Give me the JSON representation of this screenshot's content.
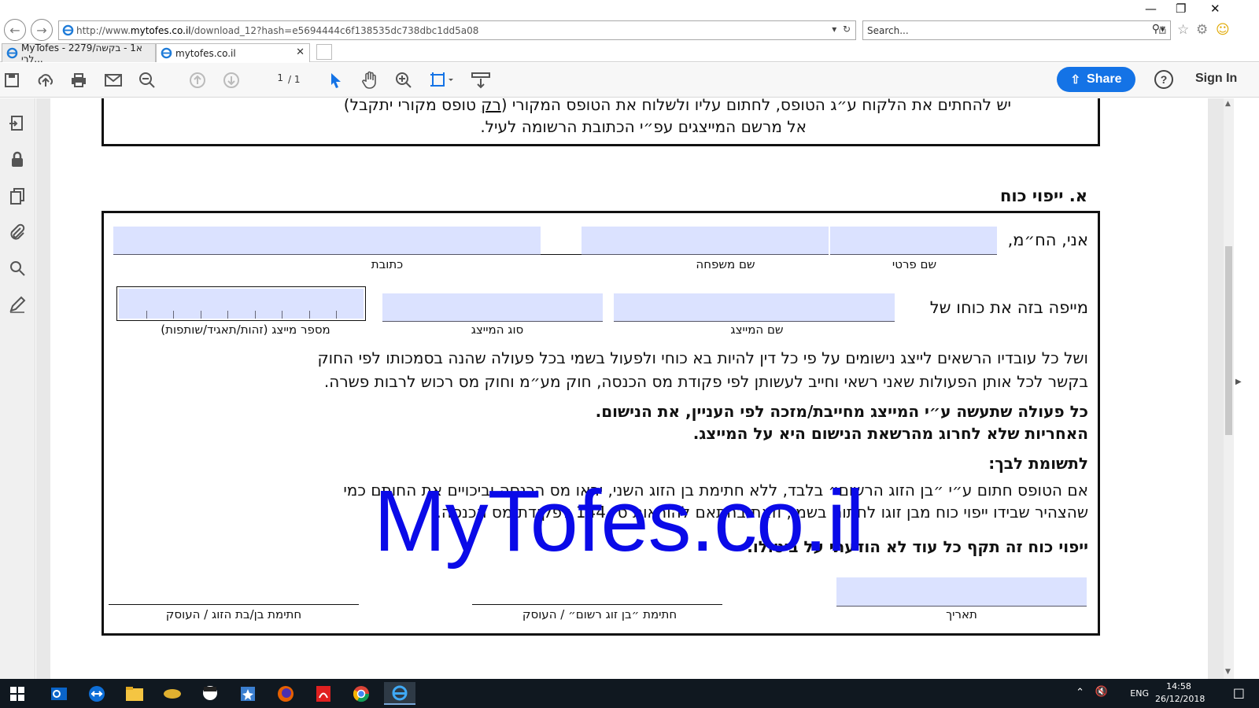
{
  "browser": {
    "address": {
      "prefix": "http://www.",
      "host": "mytofes.co.il",
      "path": "/download_12?hash=e5694444c6f138535dc738dbc1dd5a08"
    },
    "search_placeholder": "Search...",
    "tabs": [
      {
        "label": "MyTofes - 2279/א1 - בקשה לרי...",
        "active": false
      },
      {
        "label": "mytofes.co.il",
        "active": true
      }
    ]
  },
  "pdf_toolbar": {
    "page_current": "1",
    "page_total": "/ 1",
    "share_label": "Share",
    "help_label": "?",
    "signin_label": "Sign In"
  },
  "document": {
    "top_box": {
      "line1_pre": "יש להחתים את הלקוח ע״ג הטופס, לחתום עליו ולשלוח את הטופס המקורי (",
      "line1_under": "רק",
      "line1_post": " טופס מקורי יתקבל)",
      "line2": "אל מרשם המייצגים עפ״י הכתובת הרשומה לעיל."
    },
    "section_title": "א. ייפוי כוח",
    "row1_prefix": "אני, הח״מ,",
    "label_first_name": "שם פרטי",
    "label_last_name": "שם משפחה",
    "label_address": "כתובת",
    "row2_prefix": "מייפה בזה את כוחו של",
    "label_rep_name": "שם המייצג",
    "label_rep_type": "סוג המייצג",
    "label_rep_number": "מספר מייצג (זהות/תאגיד/שותפות)",
    "para1_line1": "ושל כל עובדיו הרשאים לייצג נישומים על פי כל דין להיות בא כוחי ולפעול בשמי בכל פעולה שהנה בסמכותו לפי החוק",
    "para1_line2": "בקשר לכל אותן הפעולות שאני רשאי וחייב לעשותן לפי פקודת מס הכנסה, חוק מע״מ וחוק מס רכוש לרבות פשרה.",
    "bold1_line1": "כל פעולה שתעשה ע״י המייצג מחייבת/מזכה לפי העניין, את הנישום.",
    "bold1_line2": "האחריות שלא לחרוג מהרשאת הנישום היא על המייצג.",
    "attention_title": "לתשומת לבך:",
    "para2_line1": "אם הטופס חתום ע״י ״בן הזוג הרשום״ בלבד, ללא חתימת בן הזוג השני, יראו מס הכנסה וביכויים את החותם כמי",
    "para2_line2": "שהצהיר שבידו ייפוי כוח מבן זוגו לחתום בשמו, וזאת בהתאם להוראות ס׳ 144 לפקודת מס הכנסה.",
    "validity": "ייפוי כוח זה תקף כל עוד לא הודעתי על ביטולו.",
    "label_date": "תאריך",
    "label_sig_registered": "חתימת ״בן זוג רשום״ / העוסק",
    "label_sig_spouse": "חתימת בן/בת הזוג / העוסק",
    "rep_number_digits": 9
  },
  "watermark": "MyTofes.co.il",
  "taskbar": {
    "lang": "ENG",
    "time": "14:58",
    "date": "26/12/2018"
  },
  "colors": {
    "share_blue": "#1473e6",
    "field_fill": "#dbe2ff",
    "watermark_blue": "#0a0ae8",
    "taskbar_bg": "#101820"
  },
  "icons": [
    "back-icon",
    "forward-icon",
    "ie-icon",
    "refresh-icon",
    "search-icon",
    "home-icon",
    "star-icon",
    "gear-icon",
    "smiley-icon",
    "save-icon",
    "upload-icon",
    "print-icon",
    "mail-icon",
    "zoom-out-icon",
    "page-up-icon",
    "page-down-icon",
    "select-cursor-icon",
    "hand-icon",
    "zoom-in-icon",
    "fit-icon",
    "scroll-mode-icon",
    "share-icon",
    "help-icon"
  ]
}
